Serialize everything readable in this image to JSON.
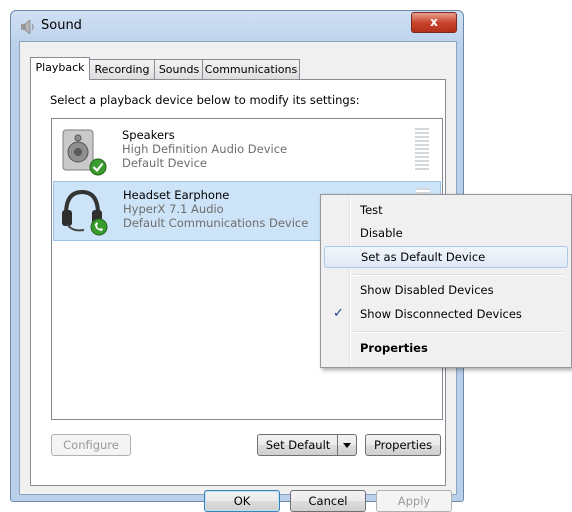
{
  "window": {
    "title": "Sound",
    "close_label": "x"
  },
  "tabs": [
    {
      "label": "Playback"
    },
    {
      "label": "Recording"
    },
    {
      "label": "Sounds"
    },
    {
      "label": "Communications"
    }
  ],
  "instruction": "Select a playback device below to modify its settings:",
  "devices": [
    {
      "name": "Speakers",
      "description": "High Definition Audio Device",
      "status": "Default Device"
    },
    {
      "name": "Headset Earphone",
      "description": "HyperX 7.1 Audio",
      "status": "Default Communications Device"
    }
  ],
  "buttons": {
    "configure": "Configure",
    "set_default": "Set Default",
    "properties": "Properties",
    "ok": "OK",
    "cancel": "Cancel",
    "apply": "Apply"
  },
  "context_menu": {
    "items": [
      {
        "label": "Test"
      },
      {
        "label": "Disable"
      },
      {
        "label": "Set as Default Device"
      },
      {
        "label": "Show Disabled Devices"
      },
      {
        "label": "Show Disconnected Devices",
        "check": "✓"
      },
      {
        "label": "Properties"
      }
    ]
  }
}
